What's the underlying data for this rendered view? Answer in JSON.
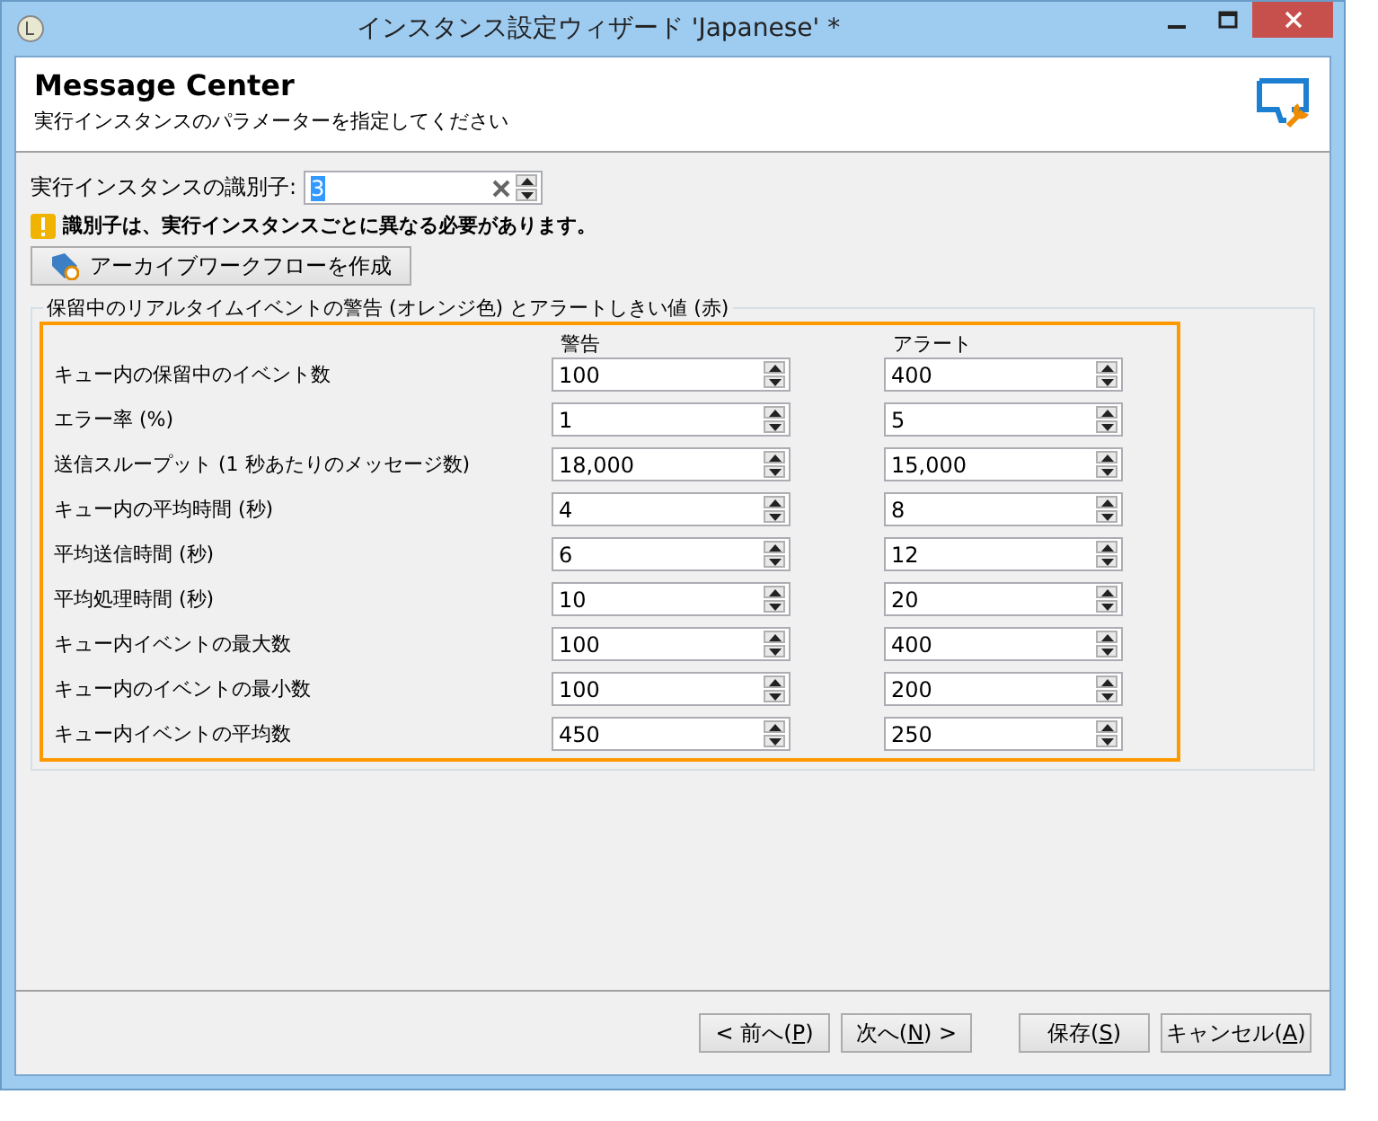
{
  "window": {
    "title": "インスタンス設定ウィザード 'Japanese' *"
  },
  "header": {
    "title": "Message Center",
    "subtitle": "実行インスタンスのパラメーターを指定してください"
  },
  "identifier": {
    "label": "実行インスタンスの識別子:",
    "value": "3"
  },
  "warning": "識別子は、実行インスタンスごとに異なる必要があります。",
  "archive_button": "アーカイブワークフローを作成",
  "group": {
    "legend": "保留中のリアルタイムイベントの警告 (オレンジ色) とアラートしきい値 (赤)",
    "columns": [
      "警告",
      "アラート"
    ],
    "rows": [
      {
        "label": "キュー内の保留中のイベント数",
        "warning": "100",
        "alert": "400"
      },
      {
        "label": "エラー率 (%)",
        "warning": "1",
        "alert": "5"
      },
      {
        "label": "送信スループット (1 秒あたりのメッセージ数)",
        "warning": "18,000",
        "alert": "15,000"
      },
      {
        "label": "キュー内の平均時間 (秒)",
        "warning": "4",
        "alert": "8"
      },
      {
        "label": "平均送信時間 (秒)",
        "warning": "6",
        "alert": "12"
      },
      {
        "label": "平均処理時間 (秒)",
        "warning": "10",
        "alert": "20"
      },
      {
        "label": "キュー内イベントの最大数",
        "warning": "100",
        "alert": "400"
      },
      {
        "label": "キュー内のイベントの最小数",
        "warning": "100",
        "alert": "200"
      },
      {
        "label": "キュー内イベントの平均数",
        "warning": "450",
        "alert": "250"
      }
    ]
  },
  "buttons": [
    {
      "before": "< 前へ(",
      "key": "P",
      "after": ")"
    },
    {
      "before": "次へ(",
      "key": "N",
      "after": ") >"
    },
    {
      "before": "保存(",
      "key": "S",
      "after": ")"
    },
    {
      "before": "キャンセル(",
      "key": "A",
      "after": ")"
    }
  ]
}
